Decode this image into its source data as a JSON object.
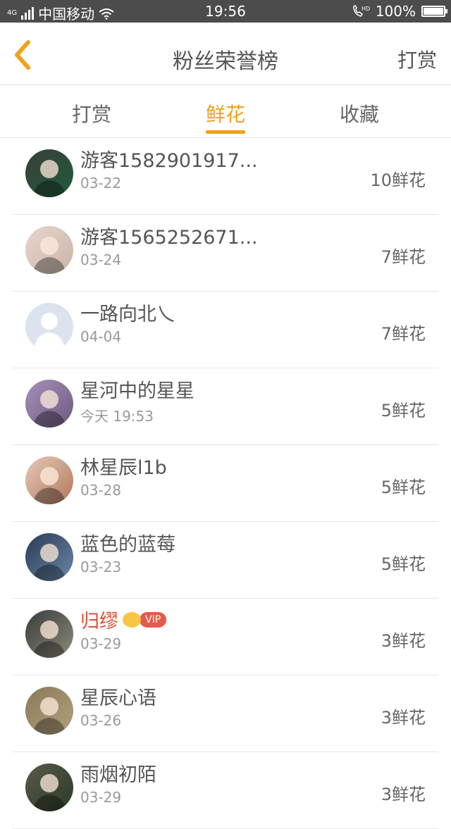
{
  "status_bar": {
    "carrier": "中国移动",
    "network": "4G",
    "time": "19:56",
    "battery": "100%",
    "battery_level": 1.0
  },
  "navbar": {
    "title": "粉丝荣誉榜",
    "right_action": "打赏"
  },
  "tabs": [
    {
      "label": "打赏",
      "active": false
    },
    {
      "label": "鲜花",
      "active": true
    },
    {
      "label": "收藏",
      "active": false
    }
  ],
  "list": [
    {
      "name": "游客1582901917...",
      "date": "03-22",
      "count": "10鲜花",
      "vip": false
    },
    {
      "name": "游客1565252671...",
      "date": "03-24",
      "count": "7鲜花",
      "vip": false
    },
    {
      "name": "一路向北乀",
      "date": "04-04",
      "count": "7鲜花",
      "vip": false
    },
    {
      "name": "星河中的星星",
      "date": "今天 19:53",
      "count": "5鲜花",
      "vip": false
    },
    {
      "name": "林星辰l1b",
      "date": "03-28",
      "count": "5鲜花",
      "vip": false
    },
    {
      "name": "蓝色的蓝莓",
      "date": "03-23",
      "count": "5鲜花",
      "vip": false
    },
    {
      "name": "归缪",
      "date": "03-29",
      "count": "3鲜花",
      "vip": true,
      "vip_label": "VIP"
    },
    {
      "name": "星辰心语",
      "date": "03-26",
      "count": "3鲜花",
      "vip": false
    },
    {
      "name": "雨烟初陌",
      "date": "03-29",
      "count": "3鲜花",
      "vip": false
    }
  ],
  "colors": {
    "accent": "#f0a21a",
    "vip_name": "#e24e34",
    "status_bar": "#4c4c4c"
  }
}
